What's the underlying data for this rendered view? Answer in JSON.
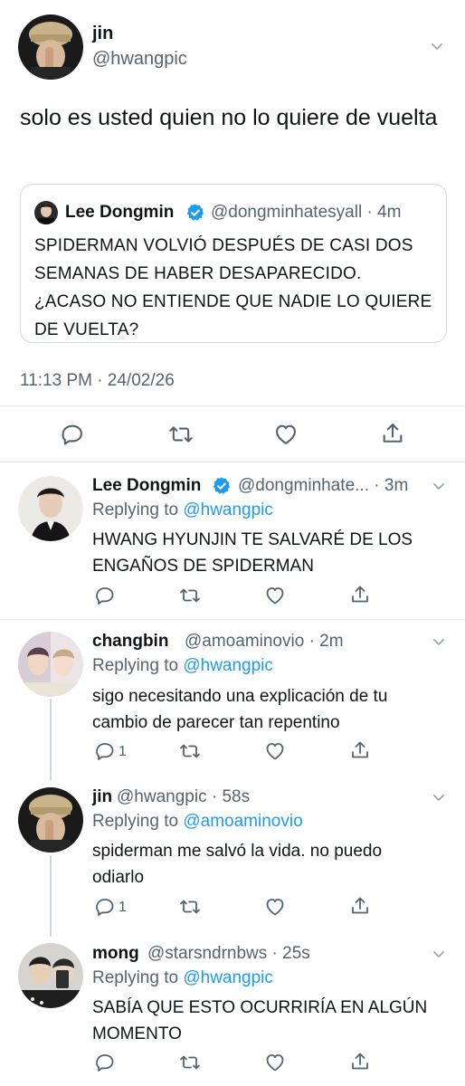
{
  "main_tweet": {
    "name": "jin",
    "handle": "@hwangpic",
    "text": "solo es usted quien no lo quiere de vuelta",
    "timestamp": "11:13 PM · 24/02/26",
    "quote": {
      "name": "Lee Dongmin",
      "verified": true,
      "handle_time": "@dongminhatesyall · 4m",
      "text": "SPIDERMAN VOLVIÓ DESPUÉS DE CASI DOS SEMANAS DE HABER DESAPARECIDO. ¿ACASO NO ENTIENDE QUE NADIE LO QUIERE DE VUELTA?"
    }
  },
  "replies": [
    {
      "name": "Lee Dongmin",
      "verified": true,
      "handle_time": "@dongminhate... · 3m",
      "replying_prefix": "Replying to ",
      "replying_to": "@hwangpic",
      "text": "HWANG HYUNJIN TE SALVARÉ DE LOS ENGAÑOS DE SPIDERMAN",
      "reply_count": ""
    },
    {
      "name": "changbin",
      "verified": false,
      "handle_time": "@amoaminovio · 2m",
      "replying_prefix": "Replying to ",
      "replying_to": "@hwangpic",
      "text": "sigo necesitando una explicación de tu cambio de parecer tan repentino",
      "reply_count": "1"
    },
    {
      "name": "jin",
      "verified": false,
      "handle_time": "@hwangpic · 58s",
      "replying_prefix": "Replying to ",
      "replying_to": "@amoaminovio",
      "text": "spiderman me salvó la vida. no puedo odiarlo",
      "reply_count": "1"
    },
    {
      "name": "mong",
      "verified": false,
      "handle_time": "@starsndrnbws · 25s",
      "replying_prefix": "Replying to ",
      "replying_to": "@hwangpic",
      "text": "SABÍA QUE ESTO OCURRIRÍA EN ALGÚN MOMENTO",
      "reply_count": ""
    }
  ],
  "icons": {
    "reply": "reply-icon",
    "retweet": "retweet-icon",
    "like": "heart-icon",
    "share": "share-icon",
    "more": "chevron-down-icon",
    "verified": "verified-badge-icon"
  },
  "colors": {
    "link": "#1d9bf0",
    "secondary_text": "#536471",
    "divider": "#e1e8ed",
    "verified": "#1d9bf0"
  }
}
